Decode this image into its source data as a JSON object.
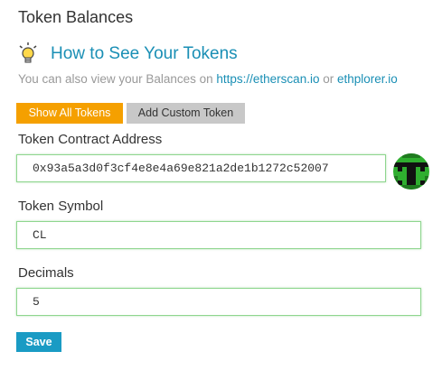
{
  "header": {
    "title": "Token Balances"
  },
  "howto": {
    "icon": "lightbulb-icon",
    "link_text": "How to See Your Tokens"
  },
  "subline": {
    "prefix": "You can also view your Balances on ",
    "link1": "https://etherscan.io",
    "middle": " or ",
    "link2": "ethplorer.io"
  },
  "buttons": {
    "show_all": "Show All Tokens",
    "add_custom": "Add Custom Token"
  },
  "form": {
    "contract_label": "Token Contract Address",
    "contract_value": "0x93a5a3d0f3cf4e8e4a69e821a2de1b1272c52007",
    "symbol_label": "Token Symbol",
    "symbol_value": "CL",
    "decimals_label": "Decimals",
    "decimals_value": "5",
    "save_label": "Save"
  },
  "colors": {
    "accent_blue": "#1a8fb5",
    "orange": "#f5a000",
    "field_border_valid": "#8fd68f",
    "identicon_green": "#2fae2f"
  },
  "identicon": {
    "icon": "address-identicon"
  }
}
